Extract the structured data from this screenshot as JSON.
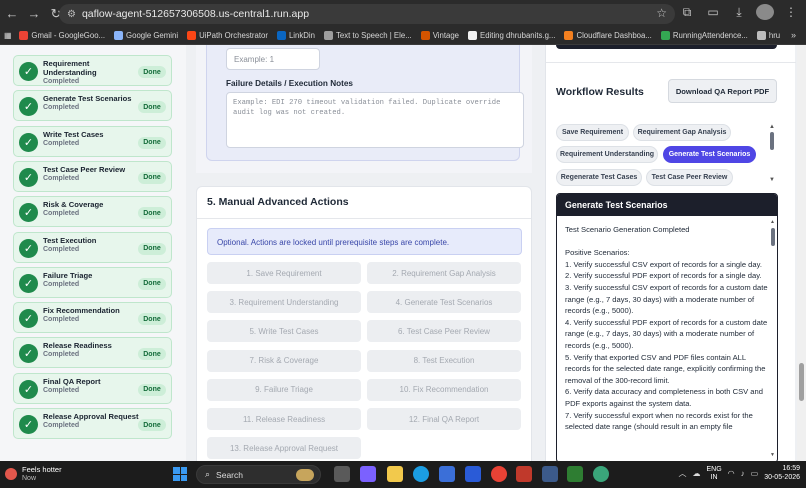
{
  "browser": {
    "url": "qaflow-agent-512657306508.us-central1.run.app",
    "bookmarks": [
      {
        "label": "Gmail - GoogleGoo...",
        "color": "#ea4335"
      },
      {
        "label": "Google Gemini",
        "color": "#8ab4f8"
      },
      {
        "label": "UiPath Orchestrator",
        "color": "#fa4616"
      },
      {
        "label": "LinkDin",
        "color": "#0a66c2"
      },
      {
        "label": "Text to Speech | Ele...",
        "color": "#9e9e9e"
      },
      {
        "label": "Vintage",
        "color": "#d35400"
      },
      {
        "label": "Editing dhrubanits.g...",
        "color": "#f0f0f0"
      },
      {
        "label": "Cloudflare Dashboa...",
        "color": "#f38020"
      },
      {
        "label": "RunningAttendence...",
        "color": "#34a853"
      },
      {
        "label": "hru",
        "color": "#bdbdbd"
      }
    ]
  },
  "steps": [
    {
      "name": "Requirement Understanding",
      "status": "Completed",
      "badge": "Done"
    },
    {
      "name": "Generate Test Scenarios",
      "status": "Completed",
      "badge": "Done"
    },
    {
      "name": "Write Test Cases",
      "status": "Completed",
      "badge": "Done"
    },
    {
      "name": "Test Case Peer Review",
      "status": "Completed",
      "badge": "Done"
    },
    {
      "name": "Risk & Coverage",
      "status": "Completed",
      "badge": "Done"
    },
    {
      "name": "Test Execution",
      "status": "Completed",
      "badge": "Done"
    },
    {
      "name": "Failure Triage",
      "status": "Completed",
      "badge": "Done"
    },
    {
      "name": "Fix Recommendation",
      "status": "Completed",
      "badge": "Done"
    },
    {
      "name": "Release Readiness",
      "status": "Completed",
      "badge": "Done"
    },
    {
      "name": "Final QA Report",
      "status": "Completed",
      "badge": "Done"
    },
    {
      "name": "Release Approval Request",
      "status": "Completed",
      "badge": "Done"
    }
  ],
  "form": {
    "small_placeholder": "Example: 1",
    "failure_label": "Failure Details / Execution Notes",
    "failure_placeholder": "Example: EDI 270 timeout validation failed. Duplicate override audit log was not created."
  },
  "manual_actions": {
    "title": "5. Manual Advanced Actions",
    "note": "Optional. Actions are locked until prerequisite steps are complete.",
    "buttons": [
      "1. Save Requirement",
      "2. Requirement Gap Analysis",
      "3. Requirement Understanding",
      "4. Generate Test Scenarios",
      "5. Write Test Cases",
      "6. Test Case Peer Review",
      "7. Risk & Coverage",
      "8. Test Execution",
      "9. Failure Triage",
      "10. Fix Recommendation",
      "11. Release Readiness",
      "12. Final QA Report",
      "13. Release Approval Request"
    ]
  },
  "results": {
    "title": "Workflow Results",
    "download_label": "Download QA Report PDF",
    "chips": [
      {
        "label": "Save Requirement",
        "active": false
      },
      {
        "label": "Requirement Gap Analysis",
        "active": false
      },
      {
        "label": "Requirement Understanding",
        "active": false
      },
      {
        "label": "Generate Test Scenarios",
        "active": true
      },
      {
        "label": "Regenerate Test Cases",
        "active": false
      },
      {
        "label": "Test Case Peer Review",
        "active": false
      }
    ],
    "panel_title": "Generate Test Scenarios",
    "lines": [
      "Test Scenario Generation Completed",
      "",
      "Positive Scenarios:",
      "1. Verify successful CSV export of records for a single day.",
      "2. Verify successful PDF export of records for a single day.",
      "3. Verify successful CSV export of records for a custom date range (e.g., 7 days, 30 days) with a moderate number of records (e.g., 5000).",
      "4. Verify successful PDF export of records for a custom date range (e.g., 7 days, 30 days) with a moderate number of records (e.g., 5000).",
      "5. Verify that exported CSV and PDF files contain ALL records for the selected date range, explicitly confirming the removal of the 300-record limit.",
      "6. Verify data accuracy and completeness in both CSV and PDF exports against the system data.",
      "7. Verify successful export when no records exist for the selected date range (should result in an empty file"
    ]
  },
  "taskbar": {
    "weather_title": "Feels hotter",
    "weather_sub": "Now",
    "search_label": "Search",
    "lang1": "ENG",
    "lang2": "IN",
    "time": "16:59",
    "date": "30-05-2026"
  }
}
